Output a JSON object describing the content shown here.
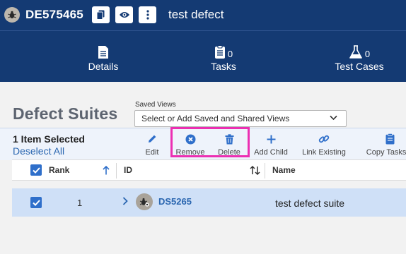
{
  "header": {
    "defect_id": "DE575465",
    "defect_name": "test defect"
  },
  "nav": {
    "details_label": "Details",
    "tasks_label": "Tasks",
    "tasks_count": "0",
    "testcases_label": "Test Cases",
    "testcases_count": "0"
  },
  "page": {
    "title": "Defect Suites",
    "saved_views_label": "Saved Views",
    "saved_views_placeholder": "Select or Add Saved and Shared Views"
  },
  "toolbar": {
    "selected_count": "1 Item Selected",
    "deselect_all": "Deselect All",
    "edit": "Edit",
    "remove": "Remove",
    "delete": "Delete",
    "add_child": "Add Child",
    "link_existing": "Link Existing",
    "copy_tasks": "Copy Tasks F"
  },
  "table": {
    "columns": {
      "rank": "Rank",
      "id": "ID",
      "name": "Name"
    },
    "rows": [
      {
        "rank": "1",
        "id": "DS5265",
        "name": "test defect suite",
        "selected": true
      }
    ]
  },
  "colors": {
    "header_bg": "#143a73",
    "accent_blue": "#2f6fca",
    "link_blue": "#2a66b0",
    "highlight_pink": "#ec2fb2",
    "selected_row": "#cfe0f7"
  }
}
